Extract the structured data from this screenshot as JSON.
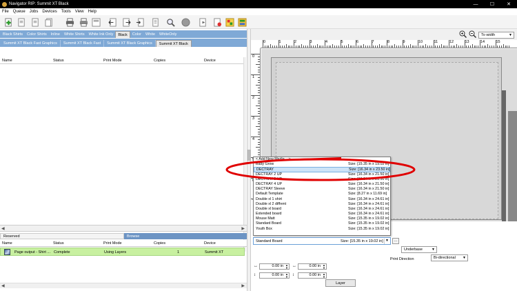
{
  "window": {
    "title": "Navigator RIP: Summit XT Black",
    "controls": [
      "—",
      "☐",
      "✕"
    ]
  },
  "menu": [
    "File",
    "Queue",
    "Jobs",
    "Devices",
    "Tools",
    "View",
    "Help"
  ],
  "queue_tabs": [
    "Black Shirts",
    "Color Shirts",
    "Inline",
    "White Shirts",
    "White Ink Only",
    "Black",
    "Color",
    "White",
    "WhiteOnly"
  ],
  "queue_tabs_active": "Black",
  "device_tabs": [
    "Summit XT Black Fast Graphics",
    "Summit XT Black Fast",
    "Summit XT Black Graphics",
    "Summit XT Black"
  ],
  "device_tabs_active": "Summit XT Black",
  "top_grid": {
    "columns": [
      "Name",
      "Status",
      "Print Mode",
      "Copies",
      "Device"
    ]
  },
  "bottom_tabs": [
    "Reserved",
    "Browse"
  ],
  "bottom_grid": {
    "columns": [
      "Name",
      "Status",
      "Print Mode",
      "Copies",
      "Device"
    ],
    "rows": [
      {
        "name": "Page output - Shirt ...",
        "status": "Complete",
        "print_mode": "Using Layers",
        "copies": "1",
        "device": "Summit XT"
      }
    ]
  },
  "zoom": {
    "value": "To width"
  },
  "ruler": {
    "h_labels": [
      "0",
      "1",
      "2",
      "3",
      "4",
      "5",
      "6",
      "7",
      "8",
      "9",
      "10",
      "11",
      "12",
      "13",
      "14",
      "15"
    ],
    "v_labels": [
      "0",
      "1",
      "2",
      "3",
      "4",
      "5",
      "6",
      "7"
    ]
  },
  "media_list": [
    {
      "name": "< Add New Media... >",
      "size": ""
    },
    {
      "name": "Baby Grow",
      "size": "Size: [15.35 in x 19.02 in]"
    },
    {
      "name": "DECTRAY",
      "size": "Size: [16.34 in x 23.50 in]"
    },
    {
      "name": "DECTRAY 2 UP",
      "size": "Size: [16.34 in x 21.50 in]"
    },
    {
      "name": "DECTRAY 3 UP",
      "size": "Size: [16.34 in x 21.50 in]"
    },
    {
      "name": "DECTRAY 4 UP",
      "size": "Size: [16.34 in x 21.50 in]"
    },
    {
      "name": "DECTRAY Sleeve",
      "size": "Size: [16.34 in x 21.50 in]"
    },
    {
      "name": "Default Template",
      "size": "Size: [8.27 in x 11.69 in]"
    },
    {
      "name": "Double xl 1 shirt",
      "size": "Size: [16.34 in x 24.61 in]"
    },
    {
      "name": "Double xl 2 diffrent",
      "size": "Size: [16.34 in x 24.61 in]"
    },
    {
      "name": "Double xl board",
      "size": "Size: [16.34 in x 24.61 in]"
    },
    {
      "name": "Extended board",
      "size": "Size: [16.34 in x 24.61 in]"
    },
    {
      "name": "Mouse Matt",
      "size": "Size: [15.35 in x 19.02 in]"
    },
    {
      "name": "Standard Board",
      "size": "Size: [15.35 in x 19.02 in]"
    },
    {
      "name": "Youth Box",
      "size": "Size: [15.35 in x 19.02 in]"
    }
  ],
  "media_selected_index": 2,
  "media_combo": {
    "value": "Standard Board",
    "size": "Size: [15.35 in x 19.02 in]",
    "button": "..."
  },
  "underbase": {
    "value": "Underbase"
  },
  "print_direction": {
    "label": "Print Direction",
    "value": "Bi-directional"
  },
  "offsets": {
    "a": "0.00 in",
    "b": "0.00 in",
    "c": "0.00 in",
    "d": "0.00 in"
  },
  "layer_button": "Layer",
  "colors": {
    "tab_blue": "#7fa9d6",
    "job_complete": "#c8f0a0",
    "annotation": "#e00000"
  }
}
